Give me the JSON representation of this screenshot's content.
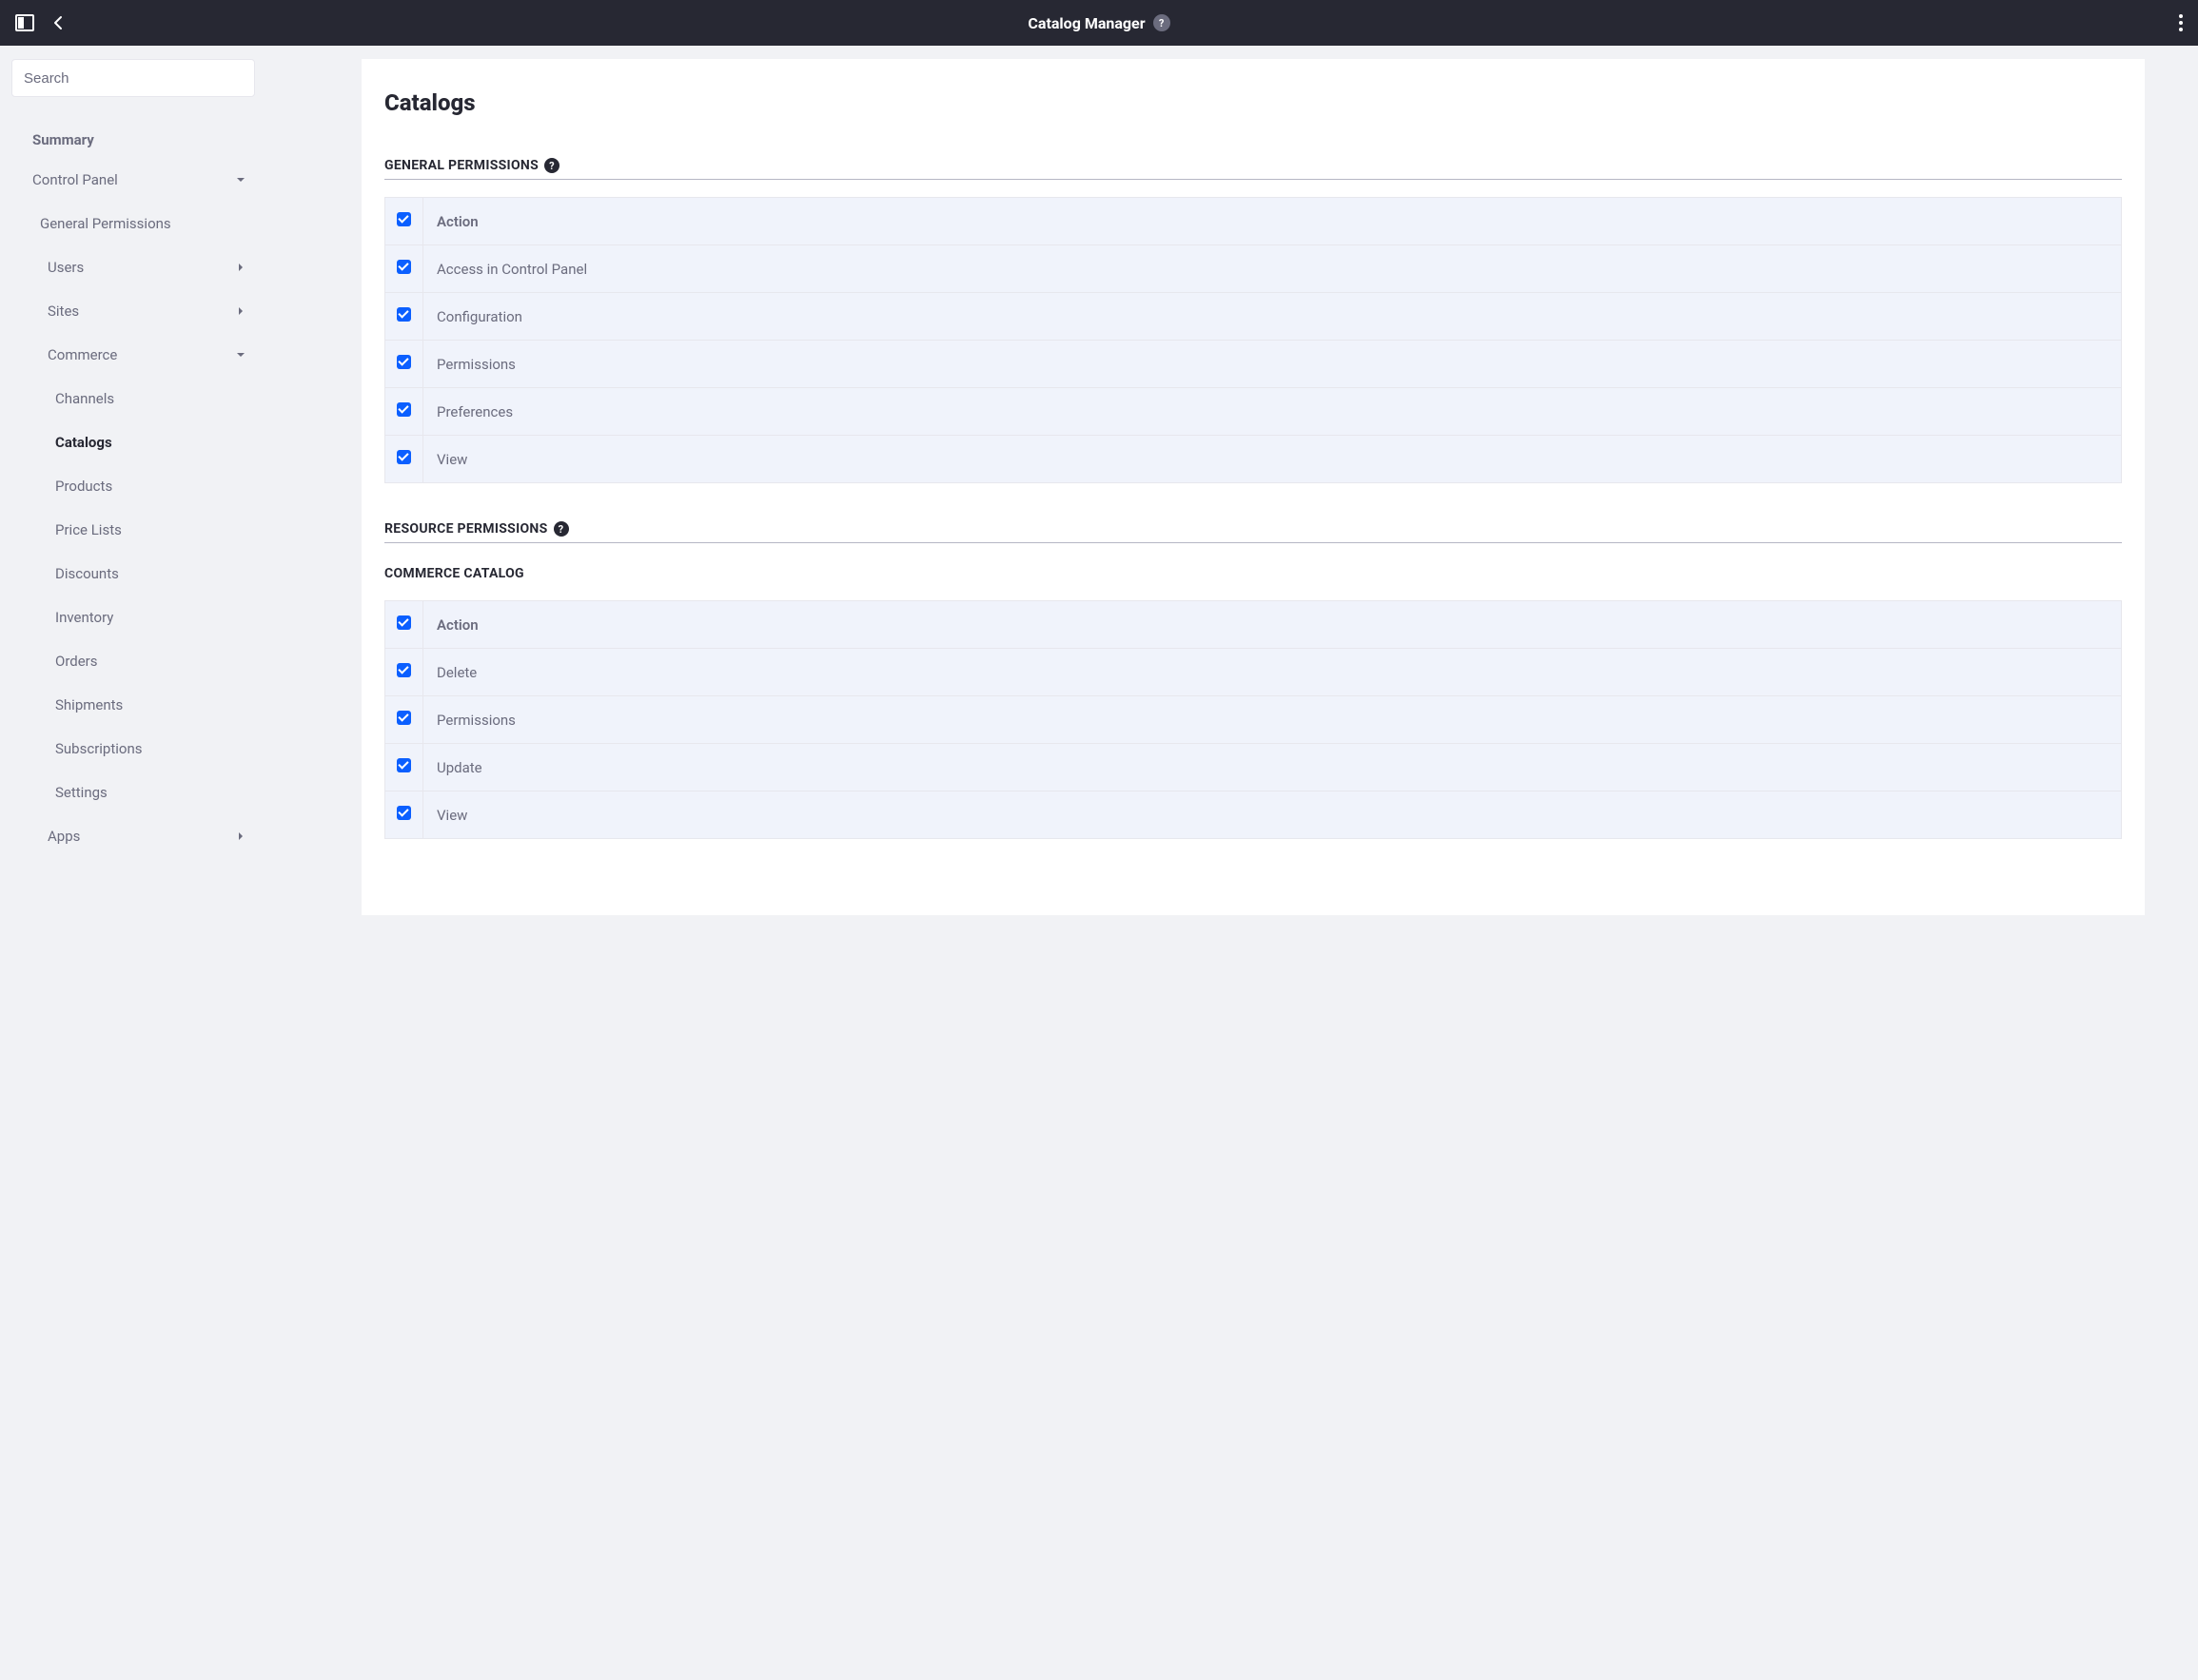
{
  "topbar": {
    "title": "Catalog Manager"
  },
  "search": {
    "placeholder": "Search"
  },
  "sidebar": {
    "summary_label": "Summary",
    "items": [
      {
        "label": "Control Panel",
        "level": 0,
        "caret": "down"
      },
      {
        "label": "General Permissions",
        "level": 1,
        "caret": ""
      },
      {
        "label": "Users",
        "level": 2,
        "caret": "right"
      },
      {
        "label": "Sites",
        "level": 2,
        "caret": "right"
      },
      {
        "label": "Commerce",
        "level": 2,
        "caret": "down"
      },
      {
        "label": "Channels",
        "level": 3,
        "caret": ""
      },
      {
        "label": "Catalogs",
        "level": 3,
        "caret": "",
        "active": true
      },
      {
        "label": "Products",
        "level": 3,
        "caret": ""
      },
      {
        "label": "Price Lists",
        "level": 3,
        "caret": ""
      },
      {
        "label": "Discounts",
        "level": 3,
        "caret": ""
      },
      {
        "label": "Inventory",
        "level": 3,
        "caret": ""
      },
      {
        "label": "Orders",
        "level": 3,
        "caret": ""
      },
      {
        "label": "Shipments",
        "level": 3,
        "caret": ""
      },
      {
        "label": "Subscriptions",
        "level": 3,
        "caret": ""
      },
      {
        "label": "Settings",
        "level": 3,
        "caret": ""
      },
      {
        "label": "Apps",
        "level": 2,
        "caret": "right"
      }
    ]
  },
  "main": {
    "title": "Catalogs",
    "general_permissions_header": "GENERAL PERMISSIONS",
    "general_permissions_action": "Action",
    "general_permissions": [
      {
        "label": "Access in Control Panel",
        "checked": true
      },
      {
        "label": "Configuration",
        "checked": true
      },
      {
        "label": "Permissions",
        "checked": true
      },
      {
        "label": "Preferences",
        "checked": true
      },
      {
        "label": "View",
        "checked": true
      }
    ],
    "resource_permissions_header": "RESOURCE PERMISSIONS",
    "resource_sub_header": "COMMERCE CATALOG",
    "resource_permissions_action": "Action",
    "resource_permissions": [
      {
        "label": "Delete",
        "checked": true
      },
      {
        "label": "Permissions",
        "checked": true
      },
      {
        "label": "Update",
        "checked": true
      },
      {
        "label": "View",
        "checked": true
      }
    ]
  }
}
